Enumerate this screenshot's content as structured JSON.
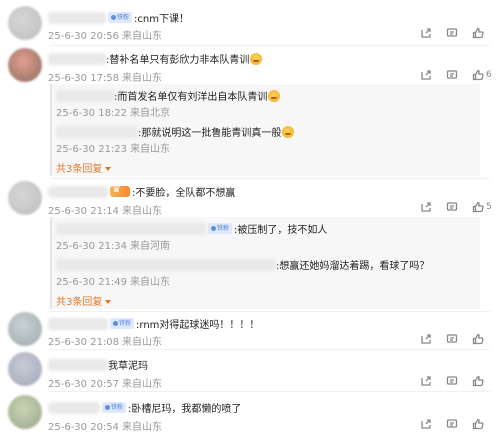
{
  "comments": [
    {
      "text": ":cnm下课！",
      "badge": "铁粉",
      "time": "25-6-30 20:56",
      "loc": "来自山东",
      "likes": ""
    },
    {
      "text": ":替补名单只有彭欣力非本队青训",
      "time": "25-6-30 17:58",
      "loc": "来自山东",
      "likes": "6",
      "replies": [
        {
          "text": ":而首发名单仅有刘洋出自本队青训",
          "time": "25-6-30 18:22",
          "loc": "来自北京"
        },
        {
          "text": ":那就说明这一批鲁能青训真一般",
          "time": "25-6-30 21:23",
          "loc": "来自山东"
        }
      ],
      "more": "共3条回复"
    },
    {
      "text": ":不要脸，全队都不想赢",
      "time": "25-6-30 21:14",
      "loc": "来自山东",
      "likes": "5",
      "replies": [
        {
          "text": ":被压制了，技不如人",
          "badge": "铁粉",
          "time": "25-6-30 21:34",
          "loc": "来自河南"
        },
        {
          "text": ":想赢还她妈溜达着踢，看球了吗？",
          "time": "25-6-30 21:49",
          "loc": "来自山东"
        }
      ],
      "more": "共3条回复"
    },
    {
      "text": ":rnm对得起球迷吗！！！！",
      "badge": "铁粉",
      "time": "25-6-30 21:08",
      "loc": "来自山东",
      "likes": ""
    },
    {
      "text": "我草泥玛",
      "time": "25-6-30 20:57",
      "loc": "来自山东",
      "likes": ""
    },
    {
      "text": ":卧槽尼玛，我都懒的喷了",
      "badge": "铁粉",
      "time": "25-6-30 20:54",
      "loc": "来自山东",
      "likes": ""
    }
  ],
  "icons": {
    "share": "share-icon",
    "comment": "comment-icon",
    "like": "like-icon"
  },
  "colors": {
    "accent": "#e4762a",
    "badge_bg": "#dfe9fb",
    "badge_text": "#4a7fe0",
    "meta": "#999999"
  }
}
